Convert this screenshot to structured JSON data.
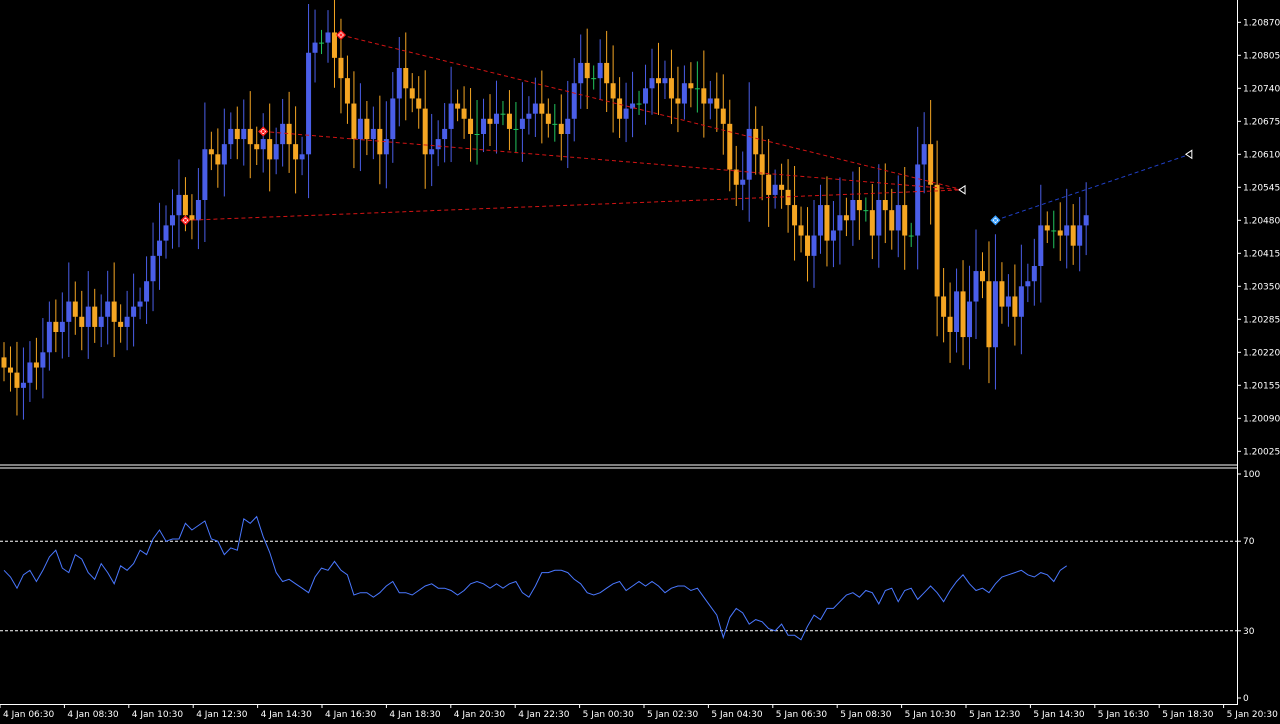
{
  "colors": {
    "background": "#000000",
    "bull_candle": "#4a5ee8",
    "bear_candle": "#f5a623",
    "doji_candle": "#22c55e",
    "trend_line": "#d21414",
    "trend_line_blue": "#2040c8",
    "oscillator": "#4a78ff",
    "level_line": "#ffffff",
    "separator": "#ffffff",
    "axis_text": "#ffffff"
  },
  "chart_data": [
    {
      "type": "candlestick",
      "ylim": [
        1.2,
        1.2091
      ],
      "price_ticks": [
        "1.20870",
        "1.20805",
        "1.20740",
        "1.20675",
        "1.20610",
        "1.20545",
        "1.20480",
        "1.20415",
        "1.20350",
        "1.20285",
        "1.20220",
        "1.20155",
        "1.20090",
        "1.20025"
      ],
      "close": [
        1.2019,
        1.2018,
        1.2015,
        1.2016,
        1.202,
        1.2019,
        1.2022,
        1.2028,
        1.2026,
        1.2028,
        1.2032,
        1.2029,
        1.2027,
        1.2031,
        1.2027,
        1.2029,
        1.2032,
        1.2028,
        1.2027,
        1.2029,
        1.2031,
        1.2032,
        1.2036,
        1.2041,
        1.2044,
        1.2047,
        1.2049,
        1.2053,
        1.2049,
        1.2048,
        1.2052,
        1.2062,
        1.2061,
        1.2059,
        1.2063,
        1.2066,
        1.2064,
        1.2066,
        1.2063,
        1.2062,
        1.2064,
        1.206,
        1.2063,
        1.2067,
        1.2063,
        1.206,
        1.2061,
        1.2081,
        1.2083,
        1.2083,
        1.2085,
        1.208,
        1.2076,
        1.2071,
        1.2064,
        1.2068,
        1.2064,
        1.2066,
        1.2061,
        1.2064,
        1.2072,
        1.2078,
        1.2074,
        1.2072,
        1.207,
        1.2061,
        1.2062,
        1.2064,
        1.2066,
        1.2071,
        1.207,
        1.2068,
        1.2065,
        1.2065,
        1.2068,
        1.2067,
        1.2069,
        1.2069,
        1.2066,
        1.2066,
        1.2068,
        1.2069,
        1.2071,
        1.2069,
        1.2067,
        1.2067,
        1.2065,
        1.2068,
        1.2075,
        1.2079,
        1.2076,
        1.2076,
        1.2079,
        1.2075,
        1.2072,
        1.2068,
        1.207,
        1.2071,
        1.2071,
        1.2074,
        1.2076,
        1.2075,
        1.2076,
        1.2072,
        1.2071,
        1.2075,
        1.2074,
        1.2074,
        1.2071,
        1.2072,
        1.207,
        1.2067,
        1.2058,
        1.2055,
        1.2056,
        1.2066,
        1.2061,
        1.2057,
        1.2053,
        1.2055,
        1.2054,
        1.2051,
        1.2047,
        1.2045,
        1.2041,
        1.2045,
        1.2051,
        1.2044,
        1.2046,
        1.2049,
        1.2048,
        1.2052,
        1.205,
        1.205,
        1.2045,
        1.2052,
        1.205,
        1.2046,
        1.2051,
        1.2045,
        1.2045,
        1.2059,
        1.2063,
        1.2055,
        1.2033,
        1.2029,
        1.2026,
        1.2034,
        1.2025,
        1.2032,
        1.2038,
        1.2036,
        1.2023,
        1.2036,
        1.2031,
        1.2033,
        1.2029,
        1.2035,
        1.2036,
        1.2039,
        1.2047,
        1.2046,
        1.2046,
        1.2045,
        1.2047,
        1.2043,
        1.2047,
        1.2049
      ]
    },
    {
      "type": "line",
      "ylim": [
        0,
        100
      ],
      "levels": [
        70,
        30
      ],
      "y_ticks": [
        "100",
        "70",
        "30",
        "0"
      ],
      "values": [
        57,
        54,
        49,
        55,
        57,
        52,
        57,
        63,
        66,
        58,
        56,
        64,
        62,
        56,
        53,
        60,
        56,
        51,
        59,
        57,
        60,
        66,
        64,
        71,
        75,
        70,
        71,
        71,
        78,
        75,
        77,
        79,
        71,
        70,
        64,
        67,
        66,
        80,
        78,
        81,
        72,
        65,
        56,
        52,
        53,
        51,
        49,
        47,
        54,
        58,
        57,
        61,
        57,
        55,
        46,
        47,
        47,
        45,
        47,
        50,
        52,
        47,
        47,
        46,
        48,
        50,
        51,
        49,
        49,
        48,
        46,
        48,
        51,
        52,
        51,
        49,
        51,
        49,
        51,
        52,
        47,
        45,
        50,
        56,
        56,
        57,
        57,
        56,
        53,
        51,
        47,
        46,
        47,
        49,
        51,
        52,
        48,
        50,
        52,
        50,
        52,
        50,
        47,
        49,
        50,
        50,
        48,
        49,
        45,
        41,
        37,
        27,
        36,
        40,
        38,
        33,
        35,
        34,
        31,
        30,
        33,
        28,
        28,
        26,
        32,
        37,
        35,
        40,
        40,
        43,
        46,
        47,
        45,
        48,
        47,
        42,
        48,
        49,
        43,
        48,
        49,
        44,
        47,
        50,
        47,
        43,
        48,
        52,
        55,
        51,
        48,
        49,
        47,
        51,
        54,
        55,
        56,
        57,
        55,
        54,
        56,
        55,
        52,
        57,
        59
      ],
      "lines": [
        [
          3,
          99
        ]
      ]
    }
  ],
  "time_axis": {
    "labels": [
      "4 Jan 06:30",
      "4 Jan 08:30",
      "4 Jan 10:30",
      "4 Jan 12:30",
      "4 Jan 14:30",
      "4 Jan 16:30",
      "4 Jan 18:30",
      "4 Jan 20:30",
      "4 Jan 22:30",
      "5 Jan 00:30",
      "5 Jan 02:30",
      "5 Jan 04:30",
      "5 Jan 06:30",
      "5 Jan 08:30",
      "5 Jan 10:30",
      "5 Jan 12:30",
      "5 Jan 14:30",
      "5 Jan 16:30",
      "5 Jan 18:30",
      "5 Jan 20:30"
    ]
  },
  "trend_lines": [
    {
      "from": [
        28,
        1.2048
      ],
      "to": [
        148,
        1.2054
      ],
      "style": "dashed",
      "color": "red"
    },
    {
      "from": [
        40,
        1.20655
      ],
      "to": [
        148,
        1.2054
      ],
      "style": "dashed",
      "color": "red"
    },
    {
      "from": [
        52,
        1.20845
      ],
      "to": [
        148,
        1.2054
      ],
      "style": "dashed",
      "color": "red"
    },
    {
      "from": [
        153,
        1.2048
      ],
      "to": [
        183,
        1.2061
      ],
      "style": "dashed",
      "color": "blue"
    }
  ],
  "markers": [
    {
      "index": 28,
      "price": 1.2048,
      "shape": "diamond",
      "color": "red"
    },
    {
      "index": 40,
      "price": 1.20655,
      "shape": "diamond",
      "color": "red"
    },
    {
      "index": 52,
      "price": 1.20845,
      "shape": "diamond",
      "color": "red"
    },
    {
      "index": 148,
      "price": 1.2054,
      "shape": "left-triangle",
      "color": "white"
    },
    {
      "index": 153,
      "price": 1.2048,
      "shape": "diamond",
      "color": "blue"
    },
    {
      "index": 183,
      "price": 1.2061,
      "shape": "left-triangle",
      "color": "white"
    }
  ]
}
